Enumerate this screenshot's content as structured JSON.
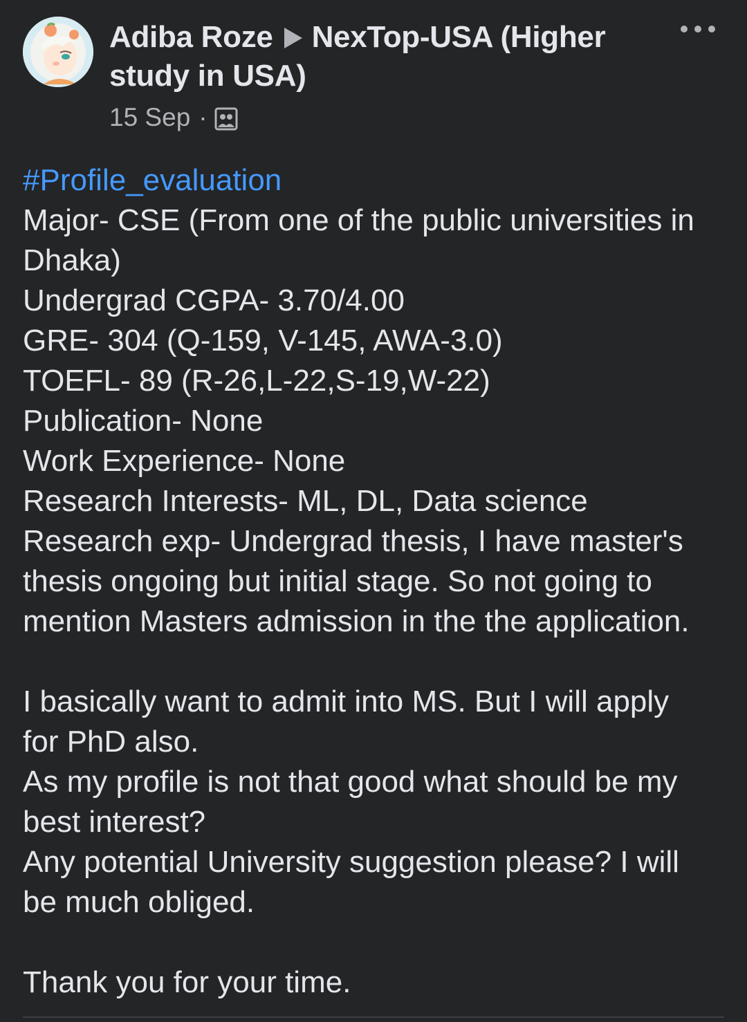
{
  "post": {
    "author": "Adiba Roze",
    "group_line1": "NexTop-USA (Higher",
    "group_line2": "study in USA)",
    "date": "15 Sep",
    "separator": "·",
    "audience_icon": "group-members-icon",
    "hashtag": "#Profile_evaluation",
    "lines": [
      "Major- CSE (From one of the public universities in",
      "Dhaka)",
      "Undergrad CGPA- 3.70/4.00",
      "GRE- 304 (Q-159, V-145, AWA-3.0)",
      "TOEFL- 89 (R-26,L-22,S-19,W-22)",
      "Publication- None",
      "Work Experience- None",
      "Research Interests- ML, DL, Data science",
      "Research exp- Undergrad thesis, I have master's",
      "thesis ongoing but initial stage. So not going to",
      "mention Masters admission in the the application."
    ],
    "lines2": [
      "I basically want to admit into MS. But I will apply",
      "for PhD also.",
      "As my profile is not that good what should be my",
      "best interest?",
      "Any potential University suggestion please? I will",
      "be much obliged."
    ],
    "closing": "Thank you for your time."
  },
  "colors": {
    "background": "#242526",
    "text": "#e4e6eb",
    "secondary": "#b0b3b8",
    "hashtag": "#4599ff"
  }
}
